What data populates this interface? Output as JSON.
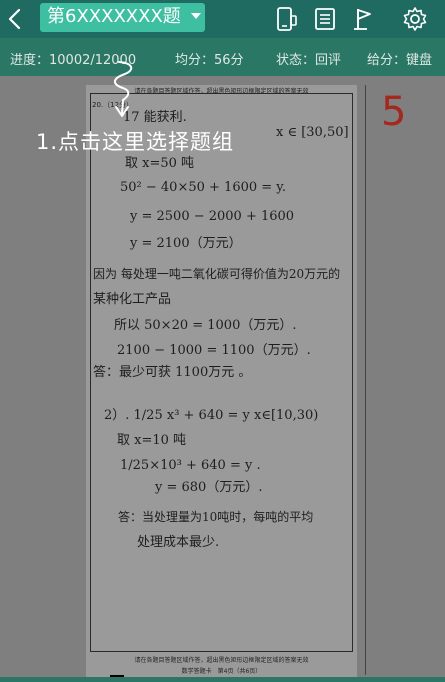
{
  "header": {
    "question_selector": "第6XXXXXXX题"
  },
  "status": {
    "progress": "进度：10002/12000",
    "average": "均分：56分",
    "state": "状态：回评",
    "input_mode": "给分：键盘"
  },
  "paper": {
    "header_notice": "请在各题目答题区域作答，超出黑色矩形边框限定区域的答案无效",
    "footer_notice": "请在各题目答题区域作答，超出黑色矩形边框限定区域的答案无效",
    "page_label": "数学答题卡　第4页（共6页）",
    "question_number": "20.（12分）",
    "lines": [
      "17 能获利.",
      "x ∈ [30,50]",
      "取 x=50 吨",
      "50² − 40×50 + 1600 = y.",
      "y = 2500 − 2000 + 1600",
      "y = 2100（万元）",
      "因为 每处理一吨二氧化碳可得价值为20万元的",
      "某种化工产品",
      "所以 50×20 = 1000（万元）.",
      "2100 − 1000 = 1100（万元）.",
      "答：最少可获 1100万元 。",
      "2）. 1/25 x³ + 640 = y   x∈[10,30)",
      "取 x=10 吨",
      "1/25×10³ + 640 = y .",
      "y = 680（万元）.",
      "答：当处理量为10吨时，每吨的平均",
      "处理成本最少."
    ]
  },
  "score": "5",
  "hint": "1.点击这里选择题组"
}
